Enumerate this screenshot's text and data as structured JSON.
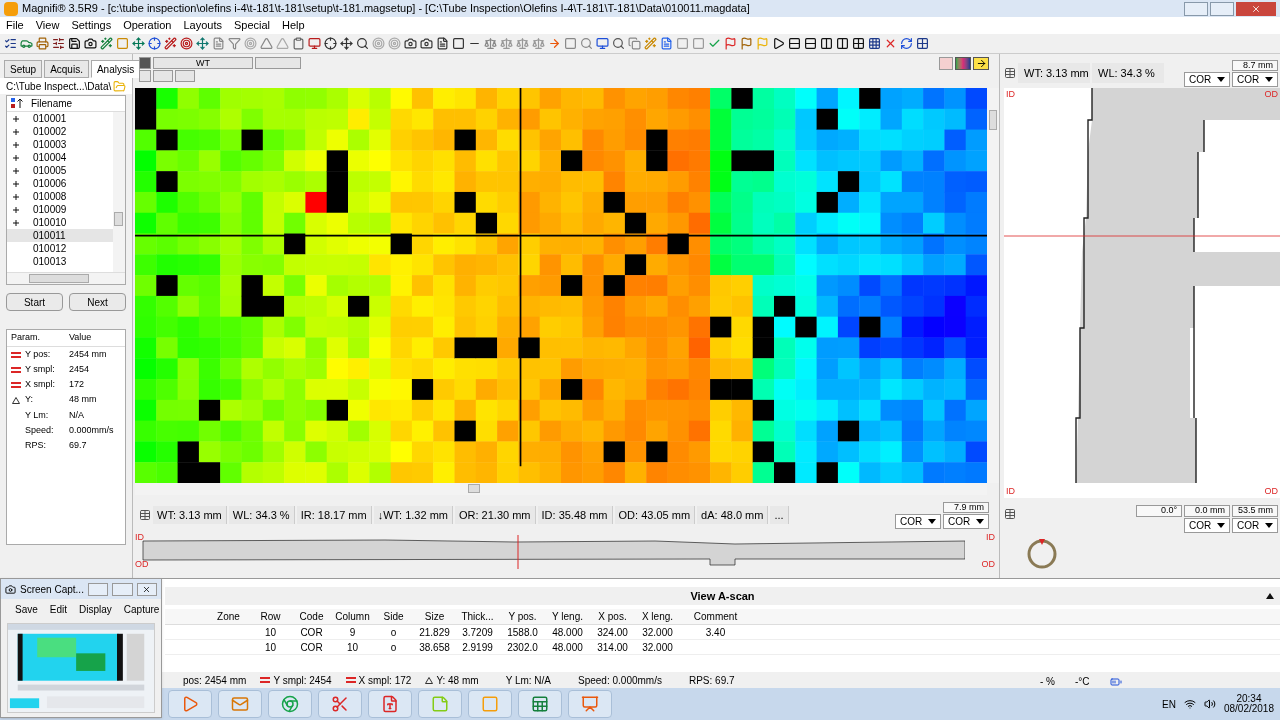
{
  "window": {
    "title": "Magnifi® 3.5R9 - [c:\\tube inspection\\olefins i-4\\t-181\\t-181\\setup\\t-181.magsetup] - [C:\\Tube Inspection\\Olefins I-4\\T-181\\T-181\\Data\\010011.magdata]"
  },
  "menu": [
    "File",
    "View",
    "Settings",
    "Operation",
    "Layouts",
    "Special",
    "Help"
  ],
  "left_tabs": [
    {
      "label": "Setup",
      "selected": false
    },
    {
      "label": "Acquis.",
      "selected": false
    },
    {
      "label": "Analysis",
      "selected": true
    }
  ],
  "path": "C:\\Tube Inspect...\\Data\\",
  "file_list": {
    "header": "Filename",
    "items": [
      {
        "name": "010001",
        "expandable": true,
        "selected": false
      },
      {
        "name": "010002",
        "expandable": true,
        "selected": false
      },
      {
        "name": "010003",
        "expandable": true,
        "selected": false
      },
      {
        "name": "010004",
        "expandable": true,
        "selected": false
      },
      {
        "name": "010005",
        "expandable": true,
        "selected": false
      },
      {
        "name": "010006",
        "expandable": true,
        "selected": false
      },
      {
        "name": "010008",
        "expandable": true,
        "selected": false
      },
      {
        "name": "010009",
        "expandable": true,
        "selected": false
      },
      {
        "name": "010010",
        "expandable": true,
        "selected": false
      },
      {
        "name": "010011",
        "expandable": false,
        "selected": true
      },
      {
        "name": "010012",
        "expandable": false,
        "selected": false
      },
      {
        "name": "010013",
        "expandable": false,
        "selected": false
      }
    ]
  },
  "buttons": [
    "Start",
    "Next"
  ],
  "params": {
    "columns": [
      "Param.",
      "Value"
    ],
    "rows": [
      {
        "kind": "equal",
        "name": "Y pos:",
        "value": "2454 mm"
      },
      {
        "kind": "equal",
        "name": "Y smpl:",
        "value": "2454"
      },
      {
        "kind": "equal",
        "name": "X smpl:",
        "value": "172"
      },
      {
        "kind": "delta",
        "name": "Y:",
        "value": "48 mm"
      },
      {
        "kind": "plain",
        "name": "Y Lm:",
        "value": "N/A"
      },
      {
        "kind": "plain",
        "name": "Speed:",
        "value": "0.000mm/s"
      },
      {
        "kind": "plain",
        "name": "RPS:",
        "value": "69.7"
      }
    ]
  },
  "cscan": {
    "tab": "WT"
  },
  "profile": {
    "readings": [
      "WT: 3.13 mm",
      "WL: 34.3 %"
    ],
    "range": "8.7 mm",
    "selects": [
      "COR",
      "COR"
    ],
    "top_left_label": "ID",
    "top_right_label": "OD",
    "bottom_left_label": "ID",
    "bottom_right_label": "OD"
  },
  "strip": {
    "readings": [
      "WT: 3.13 mm",
      "WL: 34.3 %",
      "IR: 18.17 mm",
      "↓WT: 1.32 mm",
      "OR: 21.30 mm",
      "ID: 35.48 mm",
      "OD: 43.05 mm",
      "dA: 48.0 mm",
      "..."
    ],
    "range": "7.9 mm",
    "selects": [
      "COR",
      "COR"
    ],
    "left_top_label": "ID",
    "left_bottom_label": "OD",
    "right_top_label": "ID",
    "right_bottom_label": "OD"
  },
  "ring": {
    "fields": [
      "0.0°",
      "0.0 mm",
      "53.5 mm"
    ],
    "selects": [
      "COR",
      "COR"
    ]
  },
  "table": {
    "title": "View A-scan",
    "columns": [
      "Zone",
      "Row",
      "Code",
      "Column",
      "Side",
      "Size",
      "Thick...",
      "Y pos.",
      "Y leng.",
      "X pos.",
      "X leng.",
      "Comment"
    ],
    "rows": [
      [
        null,
        "10",
        "COR",
        "9",
        "o",
        "21.829",
        "3.7209",
        "1588.0",
        "48.000",
        "324.00",
        "32.000",
        "3.40"
      ],
      [
        null,
        "10",
        "COR",
        "10",
        "o",
        "38.658",
        "2.9199",
        "2302.0",
        "48.000",
        "314.00",
        "32.000",
        null
      ]
    ]
  },
  "status_bar": [
    {
      "kind": "plain",
      "text": "pos: 2454 mm"
    },
    {
      "kind": "equal",
      "text": "Y smpl: 2454"
    },
    {
      "kind": "equal",
      "text": "X smpl: 172"
    },
    {
      "kind": "delta",
      "text": "Y: 48 mm"
    },
    {
      "kind": "plain",
      "text": "Y Lm: N/A"
    },
    {
      "kind": "plain",
      "text": "Speed: 0.000mm/s"
    },
    {
      "kind": "plain",
      "text": "RPS: 69.7"
    }
  ],
  "capture_window": {
    "title": "Screen Capt...",
    "menu": [
      "Save",
      "Edit",
      "Display",
      "Capture"
    ]
  },
  "tray": {
    "battery": "- %",
    "temperature": "-°C",
    "language": "EN",
    "time": "20:34",
    "date": "08/02/2018"
  }
}
